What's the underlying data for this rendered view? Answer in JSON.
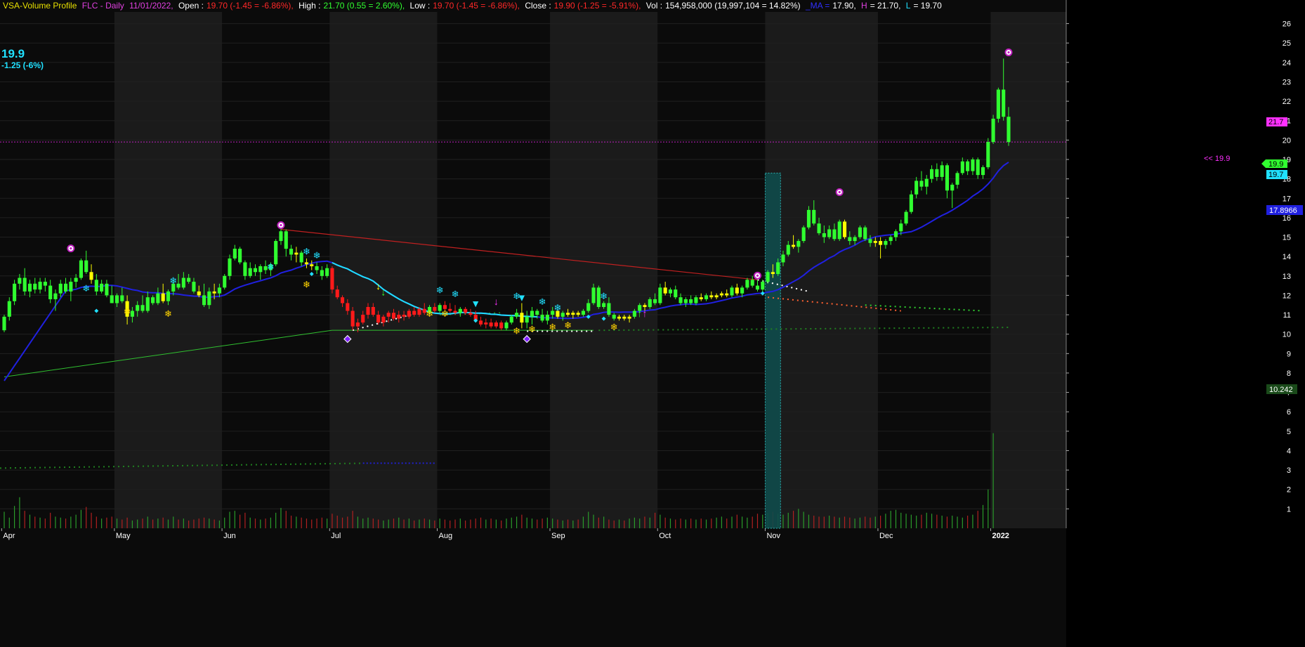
{
  "header": {
    "indicator": "VSA-Volume Profile",
    "symbol": "FLC - Daily",
    "date": "11/01/2022,",
    "open_label": "Open :",
    "open_value": "19.70 (-1.45 = -6.86%),",
    "high_label": "High :",
    "high_value": "21.70 (0.55 = 2.60%),",
    "low_label": "Low :",
    "low_value": "19.70 (-1.45 = -6.86%),",
    "close_label": "Close :",
    "close_value": "19.90 (-1.25 = -5.91%),",
    "vol_label": "Vol :",
    "vol_value": "154,958,000 (19,997,104 = 14.82%)",
    "ma_label": "_MA =",
    "ma_value": "17.90,",
    "h_label": "H",
    "h_value": "= 21.70,",
    "l_label": "L",
    "l_value": "= 19.70"
  },
  "last_price": {
    "value": "19.9",
    "change": "-1.25 (-6%)"
  },
  "price_tags": {
    "high": "21.7",
    "close": "19.9",
    "low": "19.7",
    "ma": "17.8966",
    "support": "10.242",
    "close_arrow": "<< 19.9"
  },
  "colors": {
    "up": "#30ff30",
    "down": "#ff1a1a",
    "neutral": "#ffff00",
    "ma": "#2020e0",
    "cyan": "#20e0ff",
    "magenta": "#ff30ff",
    "grid_bg_alt": "#1b1b1b",
    "bg": "#0b0b0b"
  },
  "chart_data": {
    "type": "candlestick",
    "y_axis": {
      "min": 0,
      "max": 26.6,
      "ticks": [
        1,
        2,
        3,
        4,
        5,
        6,
        7,
        8,
        9,
        10,
        11,
        12,
        13,
        14,
        15,
        16,
        17,
        18,
        19,
        20,
        21,
        22,
        23,
        24,
        25,
        26
      ]
    },
    "x_axis": {
      "labels": [
        "Apr",
        "May",
        "Jun",
        "Jul",
        "Aug",
        "Sep",
        "Oct",
        "Nov",
        "Dec",
        "2022"
      ]
    },
    "month_starts": [
      0,
      22,
      43,
      64,
      85,
      107,
      128,
      149,
      171,
      193
    ],
    "ohlc": [
      [
        10.2,
        11.0,
        10.1,
        10.9
      ],
      [
        10.9,
        11.9,
        10.7,
        11.7
      ],
      [
        11.7,
        12.8,
        11.5,
        12.6
      ],
      [
        12.6,
        13.1,
        12.3,
        12.9
      ],
      [
        12.9,
        13.4,
        12.0,
        12.2
      ],
      [
        12.2,
        12.8,
        11.9,
        12.6
      ],
      [
        12.6,
        12.9,
        12.1,
        12.3
      ],
      [
        12.3,
        12.9,
        12.1,
        12.7
      ],
      [
        12.7,
        12.9,
        12.2,
        12.5
      ],
      [
        12.5,
        12.8,
        11.6,
        11.8
      ],
      [
        11.8,
        12.3,
        11.2,
        12.1
      ],
      [
        12.1,
        12.8,
        11.9,
        12.6
      ],
      [
        12.6,
        12.9,
        12.1,
        12.2
      ],
      [
        12.2,
        12.9,
        11.7,
        12.7
      ],
      [
        12.7,
        13.1,
        12.4,
        12.9
      ],
      [
        12.9,
        13.9,
        12.8,
        13.8
      ],
      [
        13.8,
        14.3,
        13.1,
        13.2
      ],
      [
        13.2,
        13.6,
        12.6,
        12.8
      ],
      [
        12.8,
        13.1,
        12.0,
        12.2
      ],
      [
        12.2,
        12.8,
        12.1,
        12.6
      ],
      [
        12.6,
        12.8,
        11.9,
        12.0
      ],
      [
        12.0,
        12.5,
        11.6,
        11.6
      ],
      [
        11.6,
        12.1,
        11.4,
        12.0
      ],
      [
        12.0,
        12.4,
        11.6,
        11.7
      ],
      [
        11.7,
        12.0,
        10.5,
        10.9
      ],
      [
        10.9,
        11.4,
        10.6,
        11.2
      ],
      [
        11.2,
        11.7,
        10.9,
        11.5
      ],
      [
        11.5,
        12.0,
        11.1,
        11.2
      ],
      [
        11.2,
        12.2,
        11.1,
        11.9
      ],
      [
        11.9,
        12.0,
        11.5,
        11.6
      ],
      [
        11.6,
        12.4,
        11.5,
        12.1
      ],
      [
        12.1,
        12.6,
        11.6,
        11.7
      ],
      [
        11.7,
        12.3,
        11.5,
        12.2
      ],
      [
        12.2,
        12.8,
        12.0,
        12.6
      ],
      [
        12.6,
        13.1,
        12.3,
        12.4
      ],
      [
        12.4,
        13.2,
        12.3,
        12.9
      ],
      [
        12.9,
        13.1,
        12.6,
        12.7
      ],
      [
        12.7,
        12.9,
        12.1,
        12.2
      ],
      [
        12.2,
        12.5,
        11.9,
        12.0
      ],
      [
        12.0,
        12.6,
        11.4,
        11.5
      ],
      [
        11.5,
        12.4,
        11.3,
        12.2
      ],
      [
        12.2,
        12.6,
        11.8,
        12.1
      ],
      [
        12.1,
        12.6,
        11.9,
        12.4
      ],
      [
        12.4,
        13.1,
        12.3,
        13.0
      ],
      [
        13.0,
        14.1,
        12.8,
        13.9
      ],
      [
        13.9,
        14.6,
        13.8,
        14.4
      ],
      [
        14.4,
        14.5,
        13.6,
        13.7
      ],
      [
        13.7,
        13.8,
        12.8,
        13.0
      ],
      [
        13.0,
        13.7,
        12.9,
        13.4
      ],
      [
        13.4,
        13.6,
        13.0,
        13.2
      ],
      [
        13.2,
        13.6,
        12.8,
        13.5
      ],
      [
        13.5,
        13.8,
        13.1,
        13.3
      ],
      [
        13.3,
        13.7,
        13.0,
        13.6
      ],
      [
        13.6,
        14.9,
        13.5,
        14.8
      ],
      [
        14.8,
        15.6,
        14.6,
        15.3
      ],
      [
        15.3,
        15.4,
        14.0,
        14.4
      ],
      [
        14.4,
        14.6,
        13.8,
        14.1
      ],
      [
        14.1,
        14.5,
        13.7,
        14.2
      ],
      [
        14.2,
        14.3,
        13.5,
        13.7
      ],
      [
        13.7,
        13.9,
        13.4,
        13.6
      ],
      [
        13.6,
        13.8,
        13.3,
        13.5
      ],
      [
        13.5,
        13.7,
        13.1,
        13.3
      ],
      [
        13.3,
        13.5,
        12.8,
        13.0
      ],
      [
        13.0,
        13.6,
        12.9,
        13.4
      ],
      [
        13.4,
        13.5,
        12.1,
        12.3
      ],
      [
        12.3,
        12.5,
        11.8,
        11.9
      ],
      [
        11.9,
        12.0,
        11.4,
        11.6
      ],
      [
        11.6,
        11.8,
        11.0,
        11.2
      ],
      [
        11.2,
        11.4,
        10.2,
        10.4
      ],
      [
        10.4,
        10.8,
        10.1,
        10.6
      ],
      [
        10.6,
        11.2,
        10.5,
        11.0
      ],
      [
        11.0,
        11.6,
        10.8,
        11.4
      ],
      [
        11.4,
        11.6,
        10.9,
        11.0
      ],
      [
        11.0,
        11.2,
        10.5,
        10.6
      ],
      [
        10.6,
        11.0,
        10.4,
        10.9
      ],
      [
        10.9,
        11.2,
        10.6,
        11.1
      ],
      [
        11.1,
        11.3,
        10.7,
        10.8
      ],
      [
        10.8,
        11.2,
        10.6,
        11.0
      ],
      [
        11.0,
        11.2,
        10.7,
        10.9
      ],
      [
        10.9,
        11.3,
        10.8,
        11.2
      ],
      [
        11.2,
        11.4,
        10.9,
        11.0
      ],
      [
        11.0,
        11.4,
        10.9,
        11.3
      ],
      [
        11.3,
        11.6,
        11.0,
        11.1
      ],
      [
        11.1,
        11.5,
        11.0,
        11.4
      ],
      [
        11.4,
        11.6,
        11.1,
        11.2
      ],
      [
        11.2,
        11.6,
        11.1,
        11.5
      ],
      [
        11.5,
        11.7,
        11.2,
        11.3
      ],
      [
        11.3,
        11.6,
        11.1,
        11.2
      ],
      [
        11.2,
        11.5,
        11.0,
        11.1
      ],
      [
        11.1,
        11.4,
        10.9,
        11.3
      ],
      [
        11.3,
        11.4,
        11.0,
        11.1
      ],
      [
        11.1,
        11.3,
        10.9,
        11.0
      ],
      [
        11.0,
        11.2,
        10.6,
        10.7
      ],
      [
        10.7,
        10.9,
        10.4,
        10.5
      ],
      [
        10.5,
        10.8,
        10.3,
        10.6
      ],
      [
        10.6,
        10.8,
        10.3,
        10.4
      ],
      [
        10.4,
        10.7,
        10.3,
        10.6
      ],
      [
        10.6,
        10.7,
        10.2,
        10.3
      ],
      [
        10.3,
        10.7,
        10.2,
        10.6
      ],
      [
        10.6,
        11.0,
        10.5,
        10.9
      ],
      [
        10.9,
        11.3,
        10.8,
        11.1
      ],
      [
        11.1,
        11.6,
        10.3,
        10.6
      ],
      [
        10.6,
        11.2,
        10.3,
        10.9
      ],
      [
        10.9,
        11.4,
        10.5,
        11.2
      ],
      [
        11.2,
        11.3,
        10.8,
        11.0
      ],
      [
        11.0,
        11.3,
        10.6,
        10.7
      ],
      [
        10.7,
        11.2,
        10.5,
        11.0
      ],
      [
        11.0,
        11.4,
        10.8,
        11.2
      ],
      [
        11.2,
        11.3,
        10.8,
        10.9
      ],
      [
        10.9,
        11.2,
        10.7,
        11.1
      ],
      [
        11.1,
        11.3,
        10.9,
        11.0
      ],
      [
        11.0,
        11.2,
        10.8,
        11.1
      ],
      [
        11.1,
        11.2,
        10.9,
        11.0
      ],
      [
        11.0,
        11.3,
        10.9,
        11.2
      ],
      [
        11.2,
        11.8,
        11.1,
        11.6
      ],
      [
        11.6,
        12.6,
        11.5,
        12.4
      ],
      [
        12.4,
        12.5,
        11.3,
        11.4
      ],
      [
        11.4,
        11.7,
        11.3,
        11.6
      ],
      [
        11.6,
        11.9,
        10.9,
        11.0
      ],
      [
        11.0,
        11.1,
        10.7,
        10.8
      ],
      [
        10.8,
        11.0,
        10.7,
        10.9
      ],
      [
        10.9,
        11.0,
        10.7,
        10.8
      ],
      [
        10.8,
        11.0,
        10.6,
        10.9
      ],
      [
        10.9,
        11.3,
        10.8,
        11.2
      ],
      [
        11.2,
        11.6,
        11.1,
        11.5
      ],
      [
        11.5,
        11.6,
        11.2,
        11.4
      ],
      [
        11.4,
        11.9,
        11.3,
        11.8
      ],
      [
        11.8,
        12.1,
        11.5,
        11.6
      ],
      [
        11.6,
        12.6,
        11.5,
        12.4
      ],
      [
        12.4,
        12.7,
        12.0,
        12.1
      ],
      [
        12.1,
        12.4,
        11.9,
        12.3
      ],
      [
        12.3,
        12.5,
        11.8,
        11.9
      ],
      [
        11.9,
        12.1,
        11.5,
        11.6
      ],
      [
        11.6,
        11.9,
        11.4,
        11.8
      ],
      [
        11.8,
        12.0,
        11.5,
        11.6
      ],
      [
        11.6,
        12.0,
        11.5,
        11.9
      ],
      [
        11.9,
        12.1,
        11.7,
        11.8
      ],
      [
        11.8,
        12.1,
        11.7,
        12.0
      ],
      [
        12.0,
        12.2,
        11.8,
        11.9
      ],
      [
        11.9,
        12.1,
        11.8,
        12.0
      ],
      [
        12.0,
        12.2,
        11.9,
        12.1
      ],
      [
        12.1,
        12.3,
        11.9,
        12.0
      ],
      [
        12.0,
        12.5,
        11.9,
        12.4
      ],
      [
        12.4,
        12.6,
        12.0,
        12.1
      ],
      [
        12.1,
        12.5,
        11.9,
        12.4
      ],
      [
        12.4,
        12.9,
        12.3,
        12.8
      ],
      [
        12.8,
        13.0,
        12.4,
        12.5
      ],
      [
        12.5,
        12.9,
        12.2,
        12.3
      ],
      [
        12.3,
        12.8,
        12.0,
        12.7
      ],
      [
        12.7,
        13.3,
        12.6,
        13.2
      ],
      [
        13.2,
        13.6,
        12.9,
        13.1
      ],
      [
        13.1,
        13.9,
        13.0,
        13.7
      ],
      [
        13.7,
        14.3,
        13.5,
        14.1
      ],
      [
        14.1,
        14.8,
        14.0,
        14.6
      ],
      [
        14.6,
        15.1,
        14.4,
        14.5
      ],
      [
        14.5,
        14.9,
        14.2,
        14.8
      ],
      [
        14.8,
        15.6,
        14.7,
        15.5
      ],
      [
        15.5,
        16.6,
        15.4,
        16.4
      ],
      [
        16.4,
        16.9,
        15.6,
        15.7
      ],
      [
        15.7,
        16.0,
        15.1,
        15.2
      ],
      [
        15.2,
        15.6,
        14.7,
        15.0
      ],
      [
        15.0,
        15.6,
        14.9,
        15.4
      ],
      [
        15.4,
        15.7,
        14.8,
        14.9
      ],
      [
        14.9,
        15.9,
        14.8,
        15.8
      ],
      [
        15.8,
        15.9,
        14.9,
        15.0
      ],
      [
        15.0,
        15.3,
        14.6,
        14.8
      ],
      [
        14.8,
        15.1,
        14.6,
        15.0
      ],
      [
        15.0,
        15.6,
        14.9,
        15.5
      ],
      [
        15.5,
        15.6,
        14.8,
        14.9
      ],
      [
        14.9,
        15.1,
        14.5,
        14.7
      ],
      [
        14.7,
        15.0,
        14.5,
        14.8
      ],
      [
        14.8,
        15.0,
        13.9,
        14.6
      ],
      [
        14.6,
        14.9,
        14.4,
        14.8
      ],
      [
        14.8,
        15.1,
        14.6,
        15.0
      ],
      [
        15.0,
        15.4,
        14.8,
        15.3
      ],
      [
        15.3,
        15.9,
        15.1,
        15.7
      ],
      [
        15.7,
        16.4,
        15.6,
        16.3
      ],
      [
        16.3,
        17.4,
        16.2,
        17.2
      ],
      [
        17.2,
        18.1,
        17.0,
        17.9
      ],
      [
        17.9,
        18.4,
        17.4,
        17.6
      ],
      [
        17.6,
        18.2,
        17.2,
        18.0
      ],
      [
        18.0,
        18.7,
        17.8,
        18.5
      ],
      [
        18.5,
        18.8,
        17.9,
        18.1
      ],
      [
        18.1,
        18.9,
        17.9,
        18.7
      ],
      [
        18.7,
        18.8,
        17.0,
        17.4
      ],
      [
        17.4,
        17.8,
        16.5,
        17.7
      ],
      [
        17.7,
        18.4,
        17.5,
        18.3
      ],
      [
        18.3,
        19.1,
        18.2,
        18.9
      ],
      [
        18.9,
        19.0,
        18.2,
        18.4
      ],
      [
        18.4,
        19.1,
        18.2,
        19.0
      ],
      [
        19.0,
        19.1,
        18.0,
        18.2
      ],
      [
        18.2,
        18.7,
        18.0,
        18.6
      ],
      [
        18.6,
        20.1,
        18.5,
        19.9
      ],
      [
        19.9,
        21.3,
        19.8,
        21.1
      ],
      [
        21.1,
        22.7,
        20.9,
        22.6
      ],
      [
        22.6,
        24.2,
        21.0,
        21.2
      ],
      [
        21.2,
        21.7,
        19.7,
        19.9
      ]
    ],
    "volume": [
      0.85,
      0.55,
      1.15,
      1.6,
      0.9,
      0.7,
      0.6,
      0.55,
      0.5,
      0.8,
      0.6,
      0.55,
      0.5,
      0.6,
      0.7,
      0.95,
      1.1,
      0.8,
      0.6,
      0.5,
      0.55,
      0.6,
      0.5,
      0.45,
      0.55,
      0.4,
      0.45,
      0.5,
      0.6,
      0.45,
      0.5,
      0.55,
      0.45,
      0.6,
      0.45,
      0.5,
      0.4,
      0.45,
      0.5,
      0.55,
      0.5,
      0.45,
      0.4,
      0.55,
      0.85,
      0.9,
      0.7,
      0.8,
      0.55,
      0.5,
      0.45,
      0.5,
      0.55,
      0.8,
      1.05,
      0.9,
      0.65,
      0.6,
      0.55,
      0.5,
      0.45,
      0.5,
      0.55,
      0.5,
      0.75,
      0.65,
      0.55,
      0.6,
      0.9,
      0.6,
      0.5,
      0.55,
      0.5,
      0.45,
      0.4,
      0.45,
      0.5,
      0.55,
      0.45,
      0.5,
      0.4,
      0.45,
      0.5,
      0.45,
      0.4,
      0.5,
      0.45,
      0.4,
      0.45,
      0.5,
      0.4,
      0.45,
      0.5,
      0.55,
      0.45,
      0.5,
      0.45,
      0.4,
      0.5,
      0.55,
      0.6,
      0.7,
      0.55,
      0.5,
      0.45,
      0.5,
      0.55,
      0.5,
      0.45,
      0.4,
      0.45,
      0.4,
      0.45,
      0.6,
      0.85,
      0.7,
      0.55,
      0.6,
      0.45,
      0.4,
      0.45,
      0.4,
      0.5,
      0.55,
      0.5,
      0.6,
      0.55,
      0.8,
      0.7,
      0.55,
      0.5,
      0.45,
      0.5,
      0.45,
      0.5,
      0.45,
      0.5,
      0.45,
      0.5,
      0.55,
      0.6,
      0.5,
      0.6,
      0.7,
      0.6,
      0.55,
      0.6,
      0.75,
      0.7,
      0.8,
      0.85,
      0.75,
      0.7,
      0.8,
      0.9,
      1.0,
      0.85,
      0.7,
      0.65,
      0.6,
      0.6,
      0.65,
      0.6,
      0.55,
      0.6,
      0.55,
      0.5,
      0.55,
      0.6,
      0.55,
      0.6,
      0.65,
      0.75,
      0.9,
      0.95,
      0.8,
      0.75,
      0.7,
      0.65,
      0.7,
      0.8,
      0.75,
      0.7,
      0.65,
      0.6,
      0.65,
      0.6,
      0.55,
      0.65,
      0.7,
      0.9,
      1.2,
      2.0,
      4.9
    ],
    "ma_from_index": 0,
    "overlays": {
      "high_close_level": 19.9,
      "resistance_line": {
        "from": [
          54,
          15.4
        ],
        "to": [
          147,
          12.8
        ]
      },
      "long_support_line": {
        "from": [
          0,
          7.8
        ],
        "to": [
          64,
          10.2
        ]
      },
      "flat_support_line": {
        "from": [
          64,
          10.2
        ],
        "to": [
          115,
          10.2
        ]
      },
      "supply_pivots": [
        [
          13,
          14.2
        ],
        [
          54,
          15.4
        ],
        [
          147,
          12.8
        ],
        [
          163,
          17.1
        ],
        [
          196,
          24.3
        ]
      ],
      "demand_pivots": [
        [
          67,
          9.75
        ],
        [
          102,
          9.75
        ]
      ]
    }
  }
}
